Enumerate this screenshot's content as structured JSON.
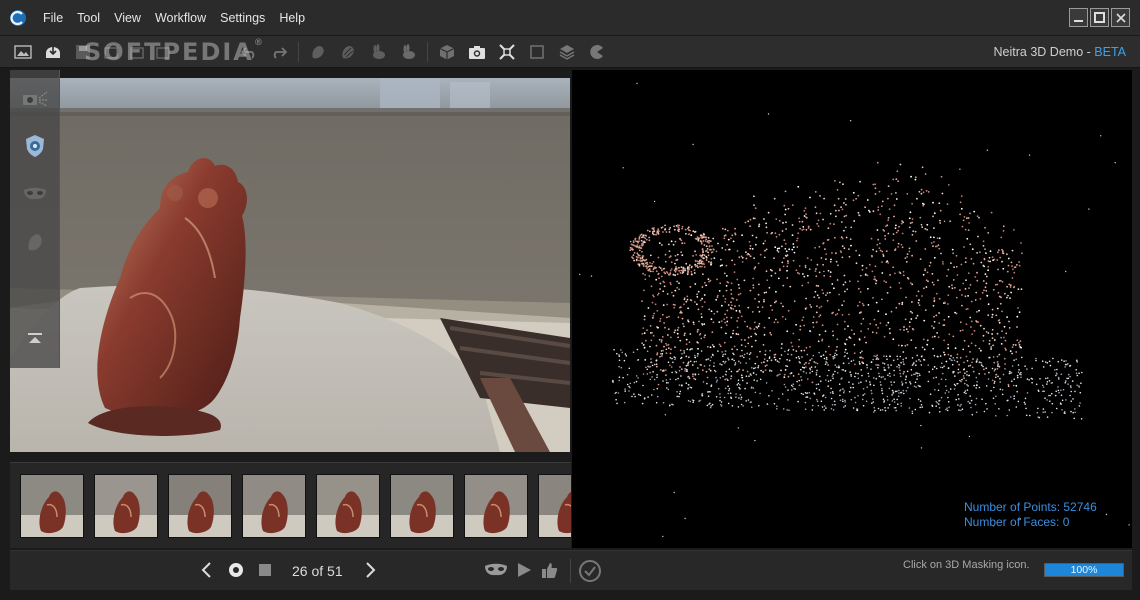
{
  "menu": [
    "File",
    "Tool",
    "View",
    "Workflow",
    "Settings",
    "Help"
  ],
  "watermark": "SOFTPEDIA",
  "watermark_mark": "®",
  "brand": {
    "name": "Neitra 3D Demo - ",
    "badge": "BETA"
  },
  "stats": {
    "points": "Number of Points: 52746",
    "faces": "Number of Faces: 0"
  },
  "nav": {
    "counter": "26 of 51"
  },
  "status": {
    "message": "Click on 3D Masking icon.",
    "progress_text": "100%",
    "progress_value": 1.0
  },
  "colors": {
    "accent": "#3aa3e8",
    "stats": "#3a8fe0",
    "progress": "#1d86d8"
  },
  "thumbnails": 8
}
